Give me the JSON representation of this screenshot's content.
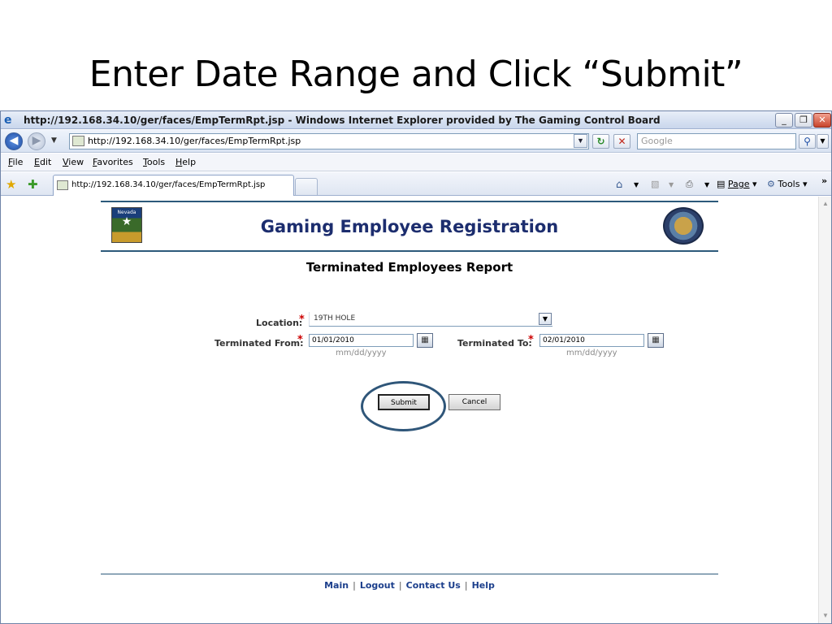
{
  "slide": {
    "title": "Enter Date Range and Click “Submit”"
  },
  "window": {
    "title": "http://192.168.34.10/ger/faces/EmpTermRpt.jsp - Windows Internet Explorer provided by The Gaming Control Board",
    "minimize": "_",
    "maximize": "❐",
    "close": "✕"
  },
  "address_bar": {
    "url": "http://192.168.34.10/ger/faces/EmpTermRpt.jsp",
    "search_placeholder": "Google"
  },
  "menu": {
    "items": [
      {
        "key": "F",
        "rest": "ile"
      },
      {
        "key": "E",
        "rest": "dit"
      },
      {
        "key": "V",
        "rest": "iew"
      },
      {
        "key": "F",
        "rest": "avorites"
      },
      {
        "key": "T",
        "rest": "ools"
      },
      {
        "key": "H",
        "rest": "elp"
      }
    ]
  },
  "tabs": {
    "active_tab": "http://192.168.34.10/ger/faces/EmpTermRpt.jsp",
    "page_label": "Page",
    "tools_label": "Tools"
  },
  "page": {
    "logo_text": "Nevada",
    "app_title": "Gaming Employee Registration",
    "report_title": "Terminated Employees Report",
    "location_label": "Location:",
    "location_value": "19TH HOLE",
    "from_label": "Terminated From:",
    "from_value": "01/01/2010",
    "to_label": "Terminated To:",
    "to_value": "02/01/2010",
    "date_hint": "mm/dd/yyyy",
    "submit_label": "Submit",
    "cancel_label": "Cancel",
    "required_mark": "*",
    "footer": [
      "Main",
      "Logout",
      "Contact Us",
      "Help"
    ],
    "footer_sep": "|"
  }
}
